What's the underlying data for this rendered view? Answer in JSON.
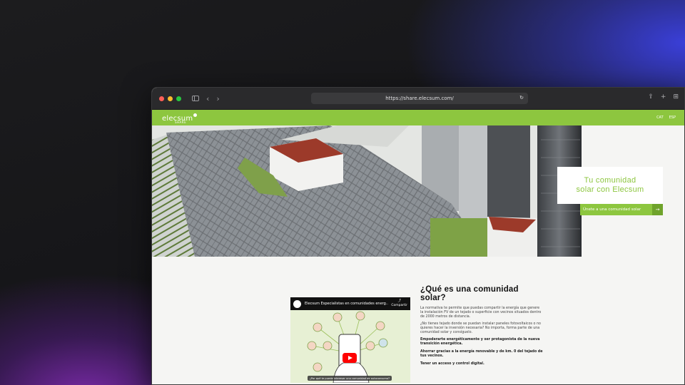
{
  "browser": {
    "url": "https://share.elecsum.com/",
    "icons": [
      "back-icon",
      "forward-icon",
      "reload-icon",
      "share-icon",
      "new-tab-icon",
      "tab-overview-icon"
    ]
  },
  "site": {
    "logo_text": "elecsum",
    "logo_sub": "SHARE",
    "langs": [
      "CAT",
      "ESP"
    ]
  },
  "hero": {
    "card_line1": "Tu comunidad",
    "card_line2": "solar con Elecsum",
    "cta_label": "Únete a una comunidad solar",
    "cta_arrow": "→"
  },
  "video": {
    "title": "Elecsum Especialistas en comunidades energ...",
    "share_label": "Compartir",
    "caption": "¿Por qué te puede interesar una comunidad de autoconsumo?"
  },
  "section": {
    "title_line1": "¿Qué es una comunidad",
    "title_line2": "solar?",
    "p1": "La normativa te permite que puedas compartir la energía que genere la instalación FV de un tejado o superficie con vecinos situados dentro de 2000 metros de distancia.",
    "p2": "¿No tienes tejado donde se puedan instalar paneles fotovoltaicos o no quieres hacer la inversión necesaria? No importa, forma parte de una comunidad solar y consíguelo.",
    "b1": "Empoderarte energéticamente y ser protagonista de la nueva transición energética.",
    "b2": "Ahorrar gracias a la energía renovable y de km. 0 del tejado de tus vecinos.",
    "b3": "Tener un acceso y control digital."
  },
  "colors": {
    "brand_green": "#8dc63f",
    "brand_green_dark": "#6fa32b"
  }
}
